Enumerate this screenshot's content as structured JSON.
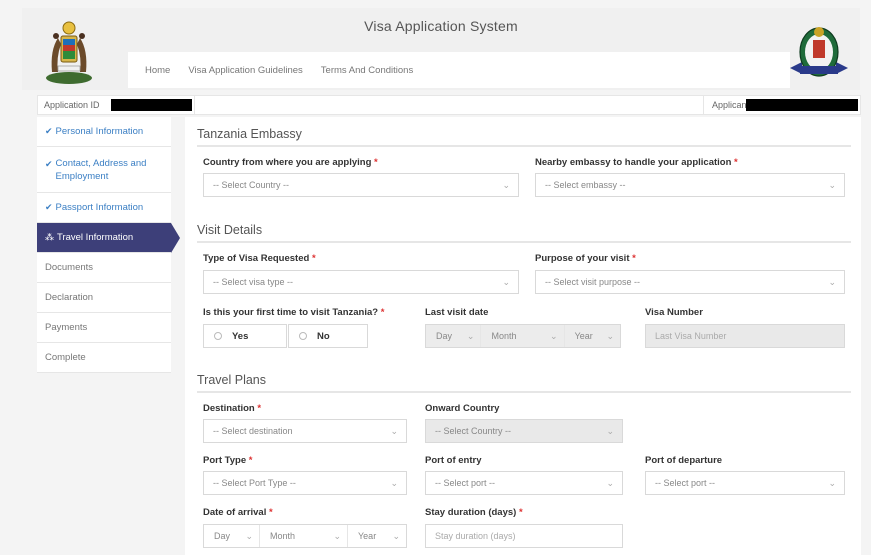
{
  "header": {
    "title": "Visa Application System",
    "nav": [
      "Home",
      "Visa Application Guidelines",
      "Terms And Conditions"
    ]
  },
  "appbar": {
    "application_id_label": "Application ID",
    "applicant_email_label": "Applicant Email"
  },
  "sidebar": {
    "items": [
      {
        "label": "Personal Information",
        "state": "done"
      },
      {
        "label": "Contact, Address and Employment",
        "state": "done"
      },
      {
        "label": "Passport Information",
        "state": "done"
      },
      {
        "label": "Travel Information",
        "state": "active"
      },
      {
        "label": "Documents",
        "state": "pending"
      },
      {
        "label": "Declaration",
        "state": "pending"
      },
      {
        "label": "Payments",
        "state": "pending"
      },
      {
        "label": "Complete",
        "state": "pending"
      }
    ]
  },
  "embassy": {
    "title": "Tanzania Embassy",
    "country_label": "Country from where you are applying",
    "country_value": "-- Select Country --",
    "embassy_label": "Nearby embassy to handle your application",
    "embassy_value": "-- Select embassy --"
  },
  "visit": {
    "title": "Visit Details",
    "visa_type_label": "Type of Visa Requested",
    "visa_type_value": "-- Select visa type --",
    "purpose_label": "Purpose of your visit",
    "purpose_value": "-- Select visit purpose --",
    "first_time_label": "Is this your first time to visit Tanzania?",
    "yes_label": "Yes",
    "no_label": "No",
    "last_visit_label": "Last visit date",
    "day": "Day",
    "month": "Month",
    "year": "Year",
    "visa_number_label": "Visa Number",
    "visa_number_placeholder": "Last Visa Number"
  },
  "travel": {
    "title": "Travel Plans",
    "destination_label": "Destination",
    "destination_value": "-- Select destination",
    "onward_label": "Onward Country",
    "onward_value": "-- Select Country --",
    "port_type_label": "Port Type",
    "port_type_value": "-- Select Port Type --",
    "port_entry_label": "Port of entry",
    "port_entry_value": "-- Select port --",
    "port_departure_label": "Port of departure",
    "port_departure_value": "-- Select port --",
    "arrival_label": "Date of arrival",
    "day": "Day",
    "month": "Month",
    "year": "Year",
    "stay_label": "Stay duration (days)",
    "stay_placeholder": "Stay duration (days)"
  },
  "colors": {
    "accent": "#3d3f79",
    "link": "#3b7fc4",
    "required": "#dd3333"
  }
}
